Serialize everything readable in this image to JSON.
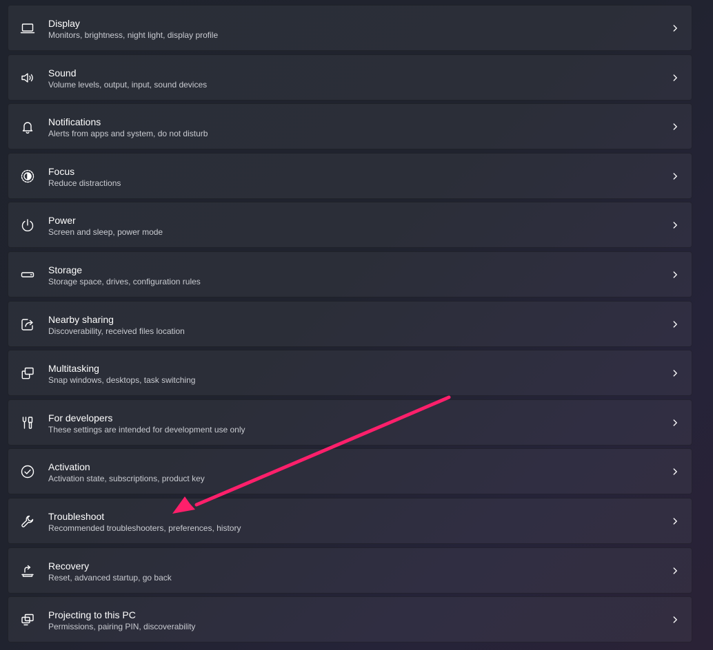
{
  "settings": {
    "items": [
      {
        "id": "display",
        "icon": "monitor-icon",
        "title": "Display",
        "subtitle": "Monitors, brightness, night light, display profile"
      },
      {
        "id": "sound",
        "icon": "speaker-icon",
        "title": "Sound",
        "subtitle": "Volume levels, output, input, sound devices"
      },
      {
        "id": "notifications",
        "icon": "bell-icon",
        "title": "Notifications",
        "subtitle": "Alerts from apps and system, do not disturb"
      },
      {
        "id": "focus",
        "icon": "focus-icon",
        "title": "Focus",
        "subtitle": "Reduce distractions"
      },
      {
        "id": "power",
        "icon": "power-icon",
        "title": "Power",
        "subtitle": "Screen and sleep, power mode"
      },
      {
        "id": "storage",
        "icon": "drive-icon",
        "title": "Storage",
        "subtitle": "Storage space, drives, configuration rules"
      },
      {
        "id": "nearby-sharing",
        "icon": "share-icon",
        "title": "Nearby sharing",
        "subtitle": "Discoverability, received files location"
      },
      {
        "id": "multitasking",
        "icon": "multitasking-icon",
        "title": "Multitasking",
        "subtitle": "Snap windows, desktops, task switching"
      },
      {
        "id": "for-developers",
        "icon": "developer-tools-icon",
        "title": "For developers",
        "subtitle": "These settings are intended for development use only"
      },
      {
        "id": "activation",
        "icon": "checkmark-circle-icon",
        "title": "Activation",
        "subtitle": "Activation state, subscriptions, product key"
      },
      {
        "id": "troubleshoot",
        "icon": "wrench-icon",
        "title": "Troubleshoot",
        "subtitle": "Recommended troubleshooters, preferences, history"
      },
      {
        "id": "recovery",
        "icon": "recovery-icon",
        "title": "Recovery",
        "subtitle": "Reset, advanced startup, go back"
      },
      {
        "id": "projecting",
        "icon": "projecting-icon",
        "title": "Projecting to this PC",
        "subtitle": "Permissions, pairing PIN, discoverability"
      }
    ]
  },
  "colors": {
    "text_primary": "#ffffff",
    "text_secondary": "#c9cbd1",
    "annotation_arrow": "#ff1f6b"
  },
  "annotation": {
    "icon": "arrow-annotation-icon",
    "target": "troubleshoot"
  }
}
